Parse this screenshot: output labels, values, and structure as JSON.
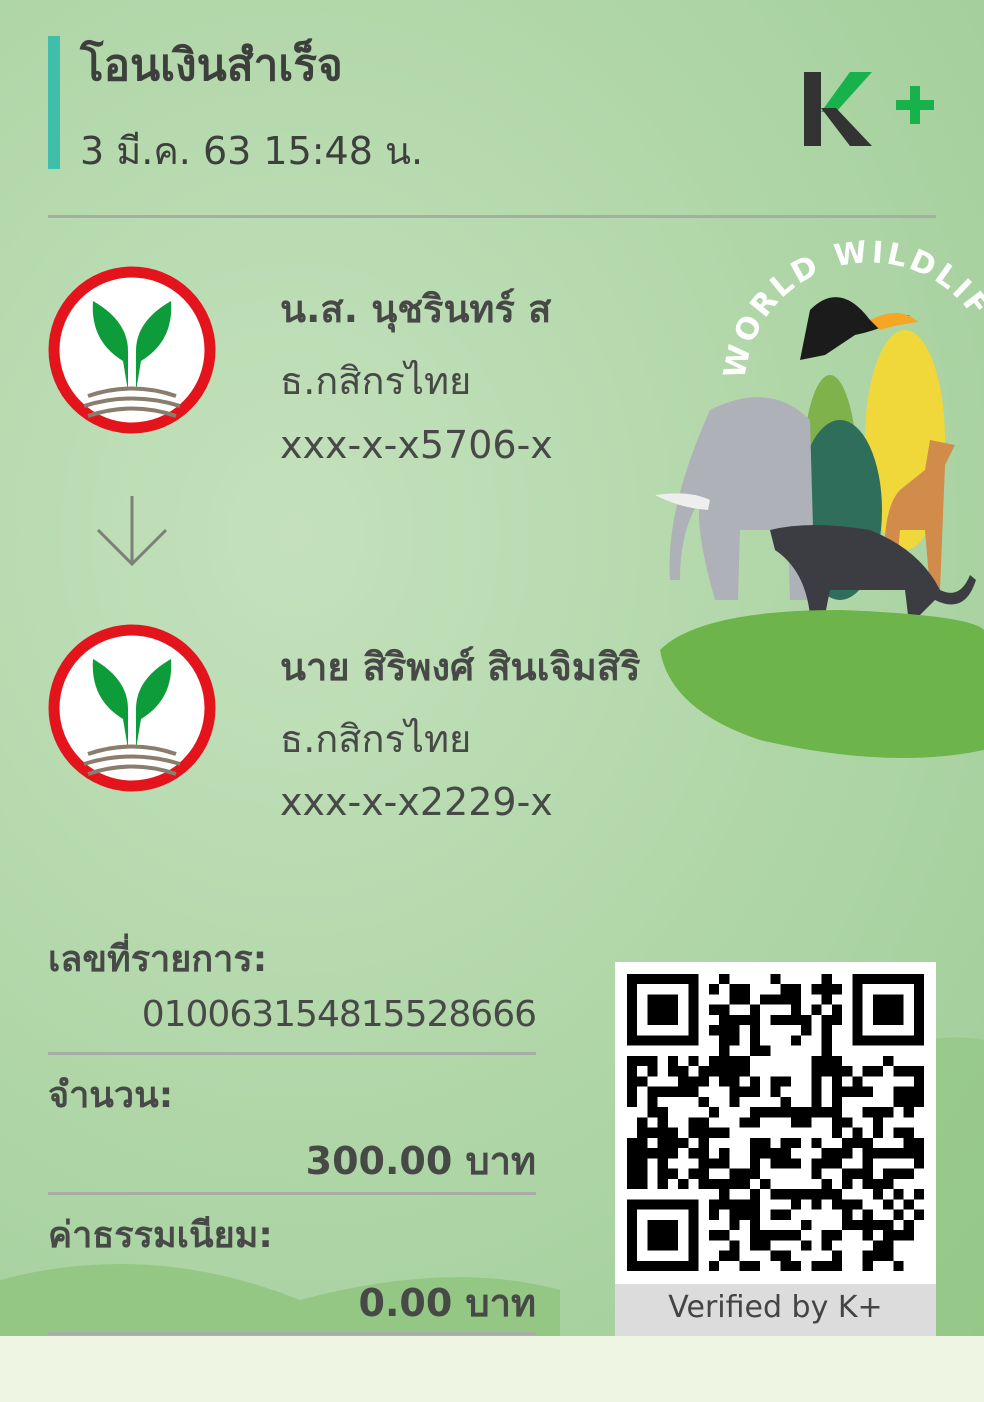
{
  "header": {
    "title": "โอนเงินสำเร็จ",
    "datetime": "3 มี.ค. 63  15:48 น.",
    "logo": "K+"
  },
  "colors": {
    "accent": "#3fbfa9",
    "logo_green": "#17b24b",
    "bank_red": "#e3141c",
    "bank_green": "#0e9b3a"
  },
  "illustration": {
    "text": "WORLD WILDLIFE DAY"
  },
  "sender": {
    "name": "น.ส. นุชรินทร์ ส",
    "bank": "ธ.กสิกรไทย",
    "account": "xxx-x-x5706-x"
  },
  "receiver": {
    "name": "นาย สิริพงศ์ สินเจิมสิริ",
    "bank": "ธ.กสิกรไทย",
    "account": "xxx-x-x2229-x"
  },
  "details": {
    "ref_label": "เลขที่รายการ:",
    "ref_value": "010063154815528666",
    "amount_label": "จำนวน:",
    "amount_value": "300.00 บาท",
    "fee_label": "ค่าธรรมเนียม:",
    "fee_value": "0.00 บาท"
  },
  "qr": {
    "caption": "Verified by K+"
  }
}
